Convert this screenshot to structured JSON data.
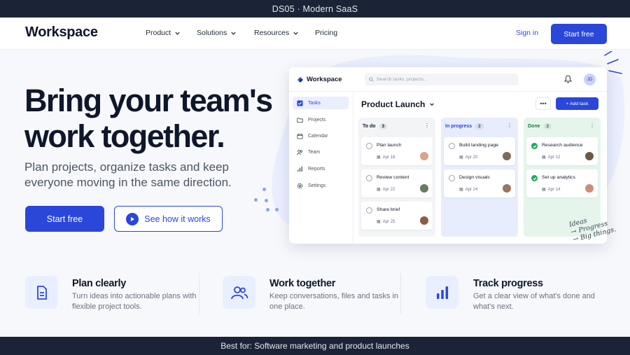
{
  "topbar": {
    "label": "DS05 · Modern SaaS"
  },
  "nav": {
    "logo": "Workspace",
    "items": [
      "Product",
      "Solutions",
      "Resources",
      "Pricing"
    ],
    "sign_in": "Sign in",
    "cta": "Start free"
  },
  "hero": {
    "headline_line1": "Bring your team's",
    "headline_line2": "work together.",
    "subcopy": "Plan projects, organize tasks and keep everyone moving in the same direction.",
    "primary_cta": "Start free",
    "secondary_cta": "See how it works"
  },
  "app": {
    "logo": "Workspace",
    "search_placeholder": "Search tasks, projects...",
    "avatar_initials": "JD",
    "sidebar": [
      "Tasks",
      "Projects",
      "Calendar",
      "Team",
      "Reports",
      "Settings"
    ],
    "active_sidebar": "Tasks",
    "board_title": "Product Launch",
    "more": "•••",
    "add_task": "+ Add task",
    "columns": [
      {
        "title": "To do",
        "count": "3",
        "cards": [
          {
            "title": "Plan launch",
            "date": "Apr 18"
          },
          {
            "title": "Review content",
            "date": "Apr 22"
          },
          {
            "title": "Share brief",
            "date": "Apr 25"
          }
        ]
      },
      {
        "title": "In progress",
        "count": "2",
        "cards": [
          {
            "title": "Build landing page",
            "date": "Apr 20"
          },
          {
            "title": "Design visuals",
            "date": "Apr 24"
          }
        ]
      },
      {
        "title": "Done",
        "count": "2",
        "cards": [
          {
            "title": "Research audience",
            "date": "Apr 12"
          },
          {
            "title": "Set up analytics",
            "date": "Apr 14"
          }
        ]
      }
    ]
  },
  "note": {
    "line1": "Ideas",
    "line2": "→ Progress",
    "line3": "→ Big things."
  },
  "features": [
    {
      "title": "Plan clearly",
      "desc": "Turn ideas into actionable plans with flexible project tools.",
      "icon": "document-icon"
    },
    {
      "title": "Work together",
      "desc": "Keep conversations, files and tasks in one place.",
      "icon": "users-icon"
    },
    {
      "title": "Track progress",
      "desc": "Get a clear view of what's done and what's next.",
      "icon": "bar-chart-icon"
    }
  ],
  "bottombar": {
    "label": "Best for: Software marketing and product launches"
  },
  "colors": {
    "accent": "#2b47d9",
    "dark": "#1b2436",
    "done": "#22a861"
  }
}
